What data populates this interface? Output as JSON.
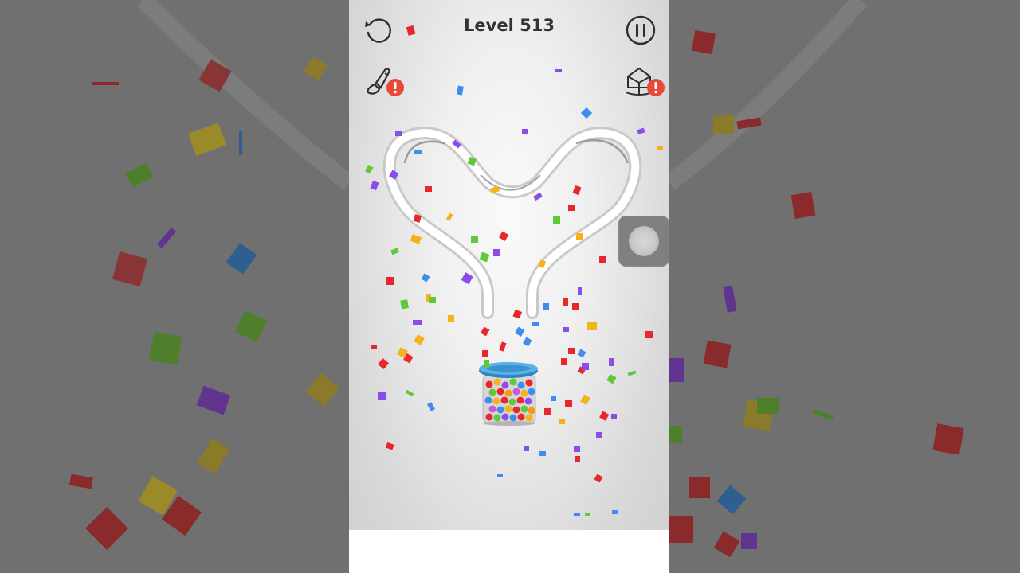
{
  "game": {
    "level_label": "Level 513"
  },
  "hud": {
    "restart_icon": "restart-icon",
    "pause_icon": "pause-icon",
    "brush_icon": "paint-brush-icon",
    "skin_icon": "cube-skin-icon",
    "alert_badge_color": "#e8483a"
  },
  "scene": {
    "track_shape": "heart",
    "container": "jar-of-balls",
    "jar_rim_color": "#4fa8dc",
    "confetti_colors": [
      "#e8262b",
      "#8a4de8",
      "#3f8df0",
      "#5fc93a",
      "#f5b21c"
    ]
  }
}
